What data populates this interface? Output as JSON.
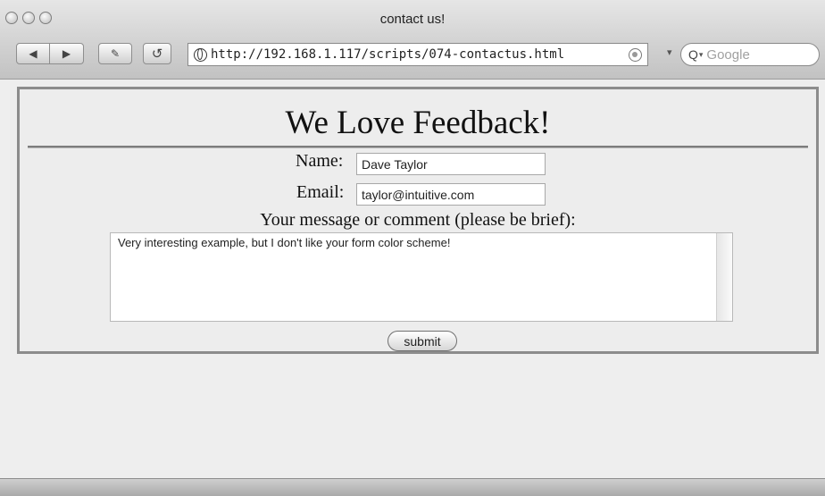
{
  "window": {
    "title": "contact us!"
  },
  "toolbar": {
    "back_icon": "◀",
    "forward_icon": "▶",
    "edit_icon": "✎",
    "reload_icon": "↺",
    "url": "http://192.168.1.117/scripts/074-contactus.html",
    "snapback_arrow": "▾",
    "search_placeholder": "Google",
    "search_icon": "Q",
    "search_arrow": "▾"
  },
  "form": {
    "heading": "We Love Feedback!",
    "name_label": "Name:",
    "name_value": "Dave Taylor",
    "email_label": "Email:",
    "email_value": "taylor@intuitive.com",
    "message_label": "Your message or comment (please be brief):",
    "message_value": "Very interesting example, but I don't like your form color scheme!",
    "submit_label": "submit"
  }
}
